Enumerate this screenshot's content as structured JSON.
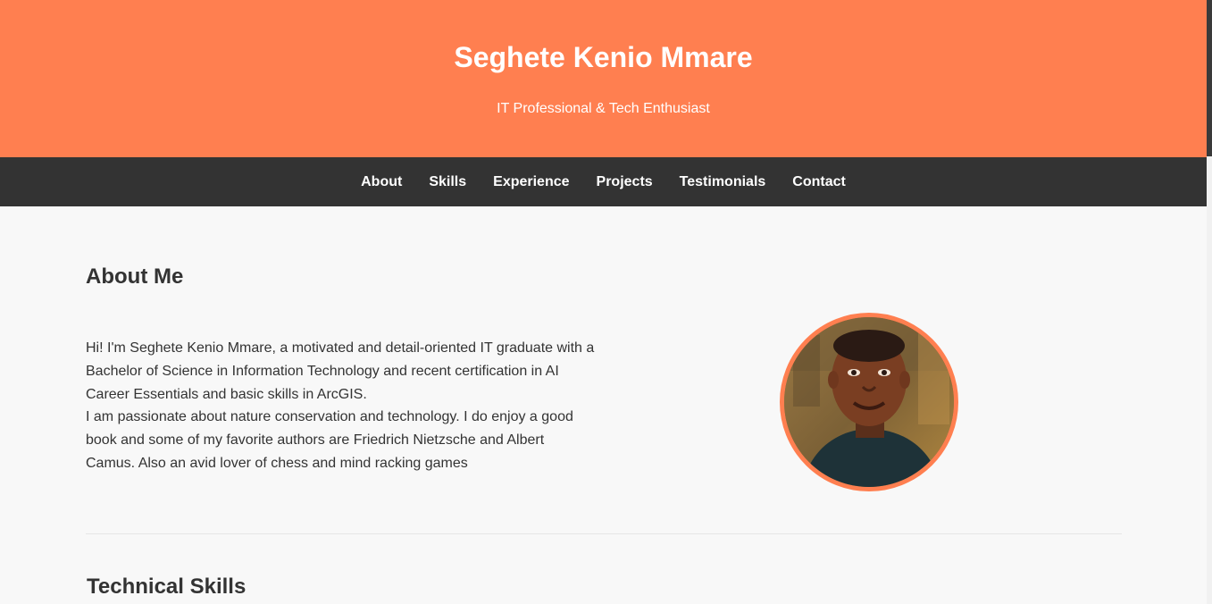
{
  "header": {
    "name": "Seghete Kenio Mmare",
    "tagline": "IT Professional & Tech Enthusiast"
  },
  "nav": {
    "items": [
      {
        "label": "About"
      },
      {
        "label": "Skills"
      },
      {
        "label": "Experience"
      },
      {
        "label": "Projects"
      },
      {
        "label": "Testimonials"
      },
      {
        "label": "Contact"
      }
    ]
  },
  "about": {
    "title": "About Me",
    "paragraph_1": "Hi! I'm Seghete Kenio Mmare, a motivated and detail-oriented IT graduate with a Bachelor of Science in Information Technology and recent certification in AI Career Essentials and basic skills in ArcGIS.",
    "paragraph_2": "I am passionate about nature conservation and technology. I do enjoy a good book and some of my favorite authors are Friedrich Nietzsche and Albert Camus. Also an avid lover of chess and mind racking games",
    "photo_icon": "profile-photo"
  },
  "skills": {
    "title": "Technical Skills"
  },
  "colors": {
    "accent": "#ff7f50",
    "nav_bg": "#333333",
    "page_bg": "#f8f8f8",
    "text": "#333333"
  }
}
